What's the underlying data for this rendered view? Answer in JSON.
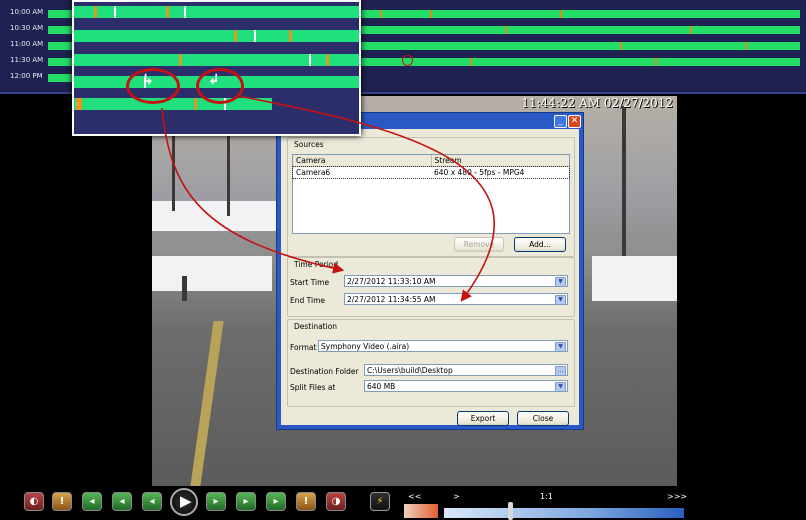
{
  "timeline": {
    "time_labels": [
      "10:00 AM",
      "10:30 AM",
      "11:00 AM",
      "11:30 AM",
      "12:00 PM"
    ]
  },
  "video": {
    "timestamp": "11:44:22 AM 02/27/2012"
  },
  "dialog": {
    "sources": {
      "title": "Sources",
      "columns": [
        "Camera",
        "Stream"
      ],
      "rows": [
        {
          "camera": "Camera6",
          "stream": "640 x 480 - 5fps - MPG4"
        }
      ],
      "remove_label": "Remove",
      "add_label": "Add..."
    },
    "time_period": {
      "title": "Time Period",
      "start_label": "Start Time",
      "start_value": "2/27/2012 11:33:10 AM",
      "end_label": "End Time",
      "end_value": "2/27/2012 11:34:55 AM"
    },
    "destination": {
      "title": "Destination",
      "format_label": "Format",
      "format_value": "Symphony Video (.aira)",
      "folder_label": "Destination Folder",
      "folder_value": "C:\\Users\\build\\Desktop",
      "folder_browse": "...",
      "split_label": "Split Files at",
      "split_value": "640 MB"
    },
    "export_label": "Export",
    "close_label": "Close"
  },
  "speed": {
    "slow_label": "<<",
    "forward_label": ">",
    "normal_label": "1:1",
    "fast_label": ">>>"
  },
  "colors": {
    "timeline_bg": "#1f2150",
    "recording_green": "#22dd66",
    "motion_orange": "#e08a1a",
    "annotation_red": "#c41212",
    "dialog_face": "#ece9d8"
  }
}
